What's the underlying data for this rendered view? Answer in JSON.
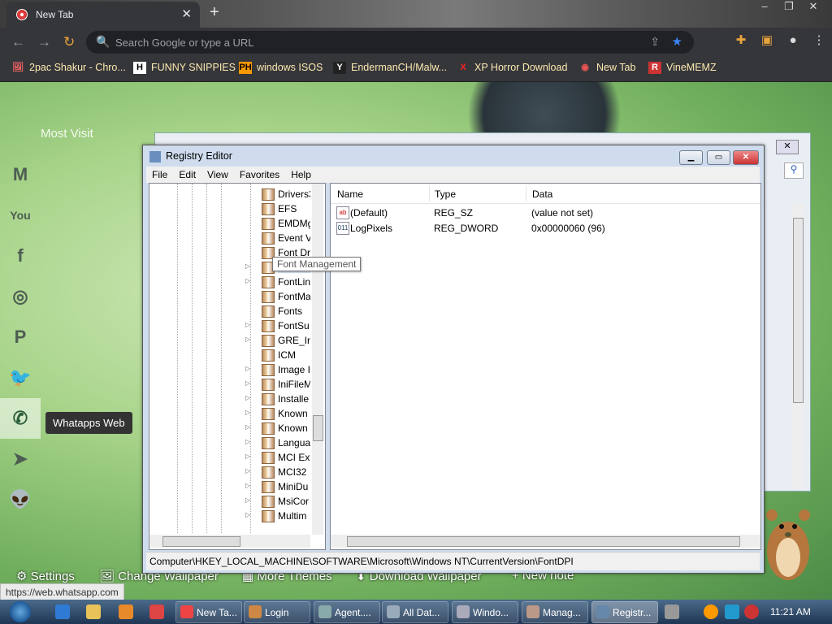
{
  "browser": {
    "tab_title": "New Tab",
    "tab_close": "✕",
    "new_tab": "+",
    "window_controls": [
      "–",
      "❐",
      "✕"
    ],
    "omnibox_placeholder": "Search Google or type a URL",
    "bookmarks": [
      {
        "icon": "🖼",
        "label": "2pac Shakur - Chro..."
      },
      {
        "icon": "H",
        "label": "FUNNY SNIPPIES"
      },
      {
        "icon": "PH",
        "label": "windows ISOS"
      },
      {
        "icon": "Y",
        "label": "EndermanCH/Malw..."
      },
      {
        "icon": "X",
        "label": "XP Horror Download"
      },
      {
        "icon": "◉",
        "label": "New Tab"
      },
      {
        "icon": "R",
        "label": "VineMEMZ"
      }
    ]
  },
  "newtab": {
    "top_links": "Most Visit",
    "social": [
      "gmail-icon",
      "youtube-icon",
      "facebook-icon",
      "instagram-icon",
      "pinterest-icon",
      "twitter-icon",
      "whatsapp-icon",
      "telegram-icon",
      "reddit-icon"
    ],
    "social_glyphs": [
      "M",
      "You",
      "f",
      "◎",
      "P",
      "🐦",
      "✆",
      "➤",
      "👽"
    ],
    "tooltip": "Whatapps Web",
    "bottom_links": [
      "⚙ Settings",
      "🖼 Change Wallpaper",
      "▦ More Themes",
      "⬇ Download Wallpaper",
      "+ New note"
    ],
    "status_url": "https://web.whatsapp.com"
  },
  "regedit": {
    "title": "Registry Editor",
    "menu": [
      "File",
      "Edit",
      "View",
      "Favorites",
      "Help"
    ],
    "tree_items": [
      "Drivers3",
      "EFS",
      "EMDMgmt",
      "Event V",
      "Font Dr",
      "Font Management",
      "FontDPI",
      "FontLin",
      "FontMa",
      "Fonts",
      "FontSu",
      "GRE_Ini",
      "ICM",
      "Image I",
      "IniFileM",
      "Installe",
      "Known",
      "Known",
      "Langua",
      "MCI Ext",
      "MCI32",
      "MiniDu",
      "MsiCor",
      "Multim"
    ],
    "tooltip": "Font Management",
    "columns": [
      "Name",
      "Type",
      "Data"
    ],
    "values": [
      {
        "icon": "ab",
        "name": "(Default)",
        "type": "REG_SZ",
        "data": "(value not set)"
      },
      {
        "icon": "011",
        "name": "LogPixels",
        "type": "REG_DWORD",
        "data": "0x00000060 (96)"
      }
    ],
    "status": "Computer\\HKEY_LOCAL_MACHINE\\SOFTWARE\\Microsoft\\Windows NT\\CurrentVersion\\FontDPI"
  },
  "taskbar": {
    "buttons": [
      {
        "label": "New Ta...",
        "color": "#e44"
      },
      {
        "label": "Login",
        "color": "#c84"
      },
      {
        "label": "Agent....",
        "color": "#8aa"
      },
      {
        "label": "All Dat...",
        "color": "#9ab"
      },
      {
        "label": "Windo...",
        "color": "#aab"
      },
      {
        "label": "Manag...",
        "color": "#b98"
      },
      {
        "label": "Registr...",
        "color": "#68a"
      }
    ],
    "time": "11:21 AM"
  }
}
